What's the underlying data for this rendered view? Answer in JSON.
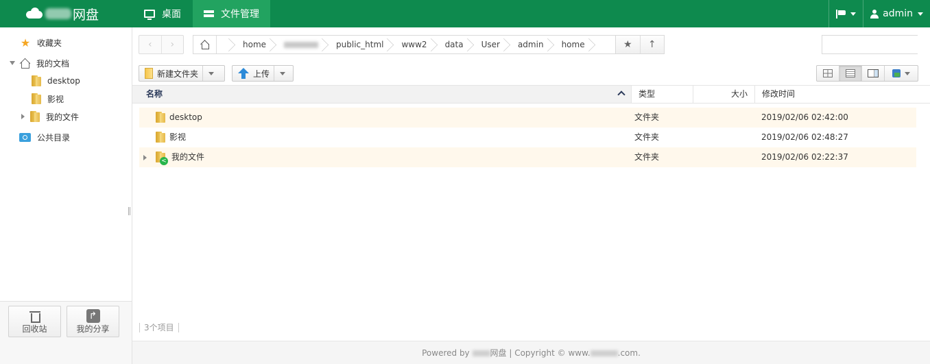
{
  "app": {
    "brand_suffix": "网盘"
  },
  "nav": {
    "tabs": [
      {
        "label": "桌面",
        "icon": "monitor-icon"
      },
      {
        "label": "文件管理",
        "icon": "drive-icon",
        "active": true
      }
    ],
    "user": "admin"
  },
  "sidebar": {
    "favorites": "收藏夹",
    "my_docs": "我的文档",
    "children": [
      "desktop",
      "影视",
      "我的文件"
    ],
    "public": "公共目录",
    "recycle_label": "回收站",
    "share_label": "我的分享"
  },
  "breadcrumb": {
    "items": [
      "home",
      "",
      "public_html",
      "www2",
      "data",
      "User",
      "admin",
      "home"
    ]
  },
  "search": {
    "placeholder": ""
  },
  "toolbar": {
    "new_folder": "新建文件夹",
    "upload": "上传"
  },
  "table": {
    "headers": {
      "name": "名称",
      "type": "类型",
      "size": "大小",
      "modified": "修改时间"
    },
    "rows": [
      {
        "name": "desktop",
        "type": "文件夹",
        "size": "",
        "modified": "2019/02/06 02:42:00"
      },
      {
        "name": "影视",
        "type": "文件夹",
        "size": "",
        "modified": "2019/02/06 02:48:27"
      },
      {
        "name": "我的文件",
        "type": "文件夹",
        "size": "",
        "modified": "2019/02/06 02:22:37"
      }
    ]
  },
  "status": {
    "count": "3个项目"
  },
  "footer": {
    "powered_by": "Powered by",
    "brand": "网盘",
    "copyright": "| Copyright © www.",
    "domain_end": ".com."
  },
  "colors": {
    "topbar": "#0e8a4e",
    "active_tab": "#22a360",
    "row_alt": "#fff8ec"
  }
}
